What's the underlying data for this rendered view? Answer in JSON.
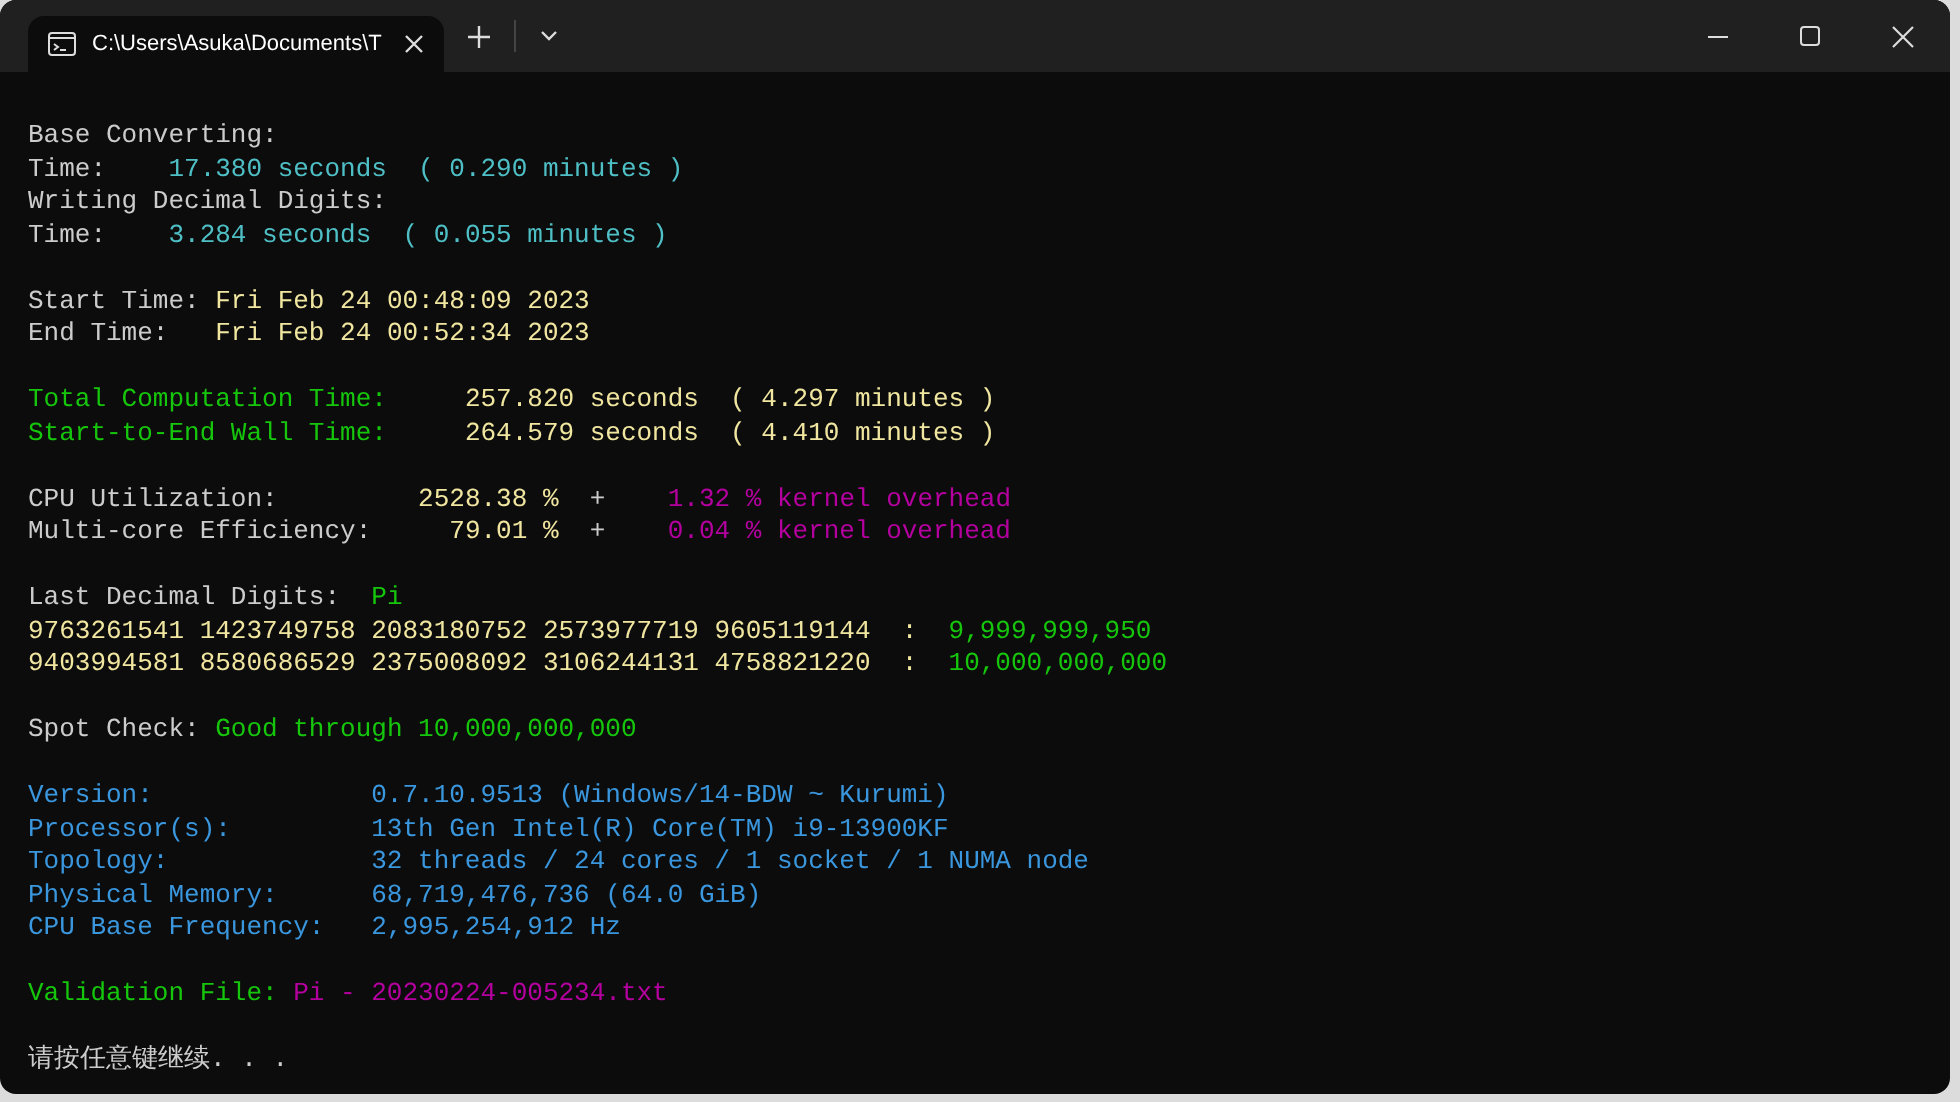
{
  "window": {
    "tab": {
      "title": "C:\\Users\\Asuka\\Documents\\T",
      "selected": true
    }
  },
  "terminal": {
    "blocks": [
      {
        "lines": [
          [
            {
              "text": "Base Converting:",
              "color": "#cccccc"
            }
          ],
          [
            {
              "text": "Time:    ",
              "color": "#cccccc"
            },
            {
              "text": "17.380 seconds  ( 0.290 minutes )",
              "color": "#4fbfc6"
            }
          ],
          [
            {
              "text": "Writing Decimal Digits:",
              "color": "#cccccc"
            }
          ],
          [
            {
              "text": "Time:    ",
              "color": "#cccccc"
            },
            {
              "text": "3.284 seconds  ( 0.055 minutes )",
              "color": "#4fbfc6"
            }
          ]
        ]
      },
      {
        "lines": [
          [
            {
              "text": "Start Time: ",
              "color": "#cccccc"
            },
            {
              "text": "Fri Feb 24 00:48:09 2023",
              "color": "#f0e6a0"
            }
          ],
          [
            {
              "text": "End Time:   ",
              "color": "#cccccc"
            },
            {
              "text": "Fri Feb 24 00:52:34 2023",
              "color": "#f0e6a0"
            }
          ]
        ]
      },
      {
        "lines": [
          [
            {
              "text": "Total Computation Time:     ",
              "color": "#16c60c"
            },
            {
              "text": "257.820 seconds  ( 4.297 minutes )",
              "color": "#f0e6a0"
            }
          ],
          [
            {
              "text": "Start-to-End Wall Time:     ",
              "color": "#16c60c"
            },
            {
              "text": "264.579 seconds  ( 4.410 minutes )",
              "color": "#f0e6a0"
            }
          ]
        ]
      },
      {
        "lines": [
          [
            {
              "text": "CPU Utilization:         ",
              "color": "#cccccc"
            },
            {
              "text": "2528.38 %",
              "color": "#f0e6a0"
            },
            {
              "text": "  +    ",
              "color": "#cccccc"
            },
            {
              "text": "1.32 % kernel overhead",
              "color": "#b4009e"
            }
          ],
          [
            {
              "text": "Multi-core Efficiency:     ",
              "color": "#cccccc"
            },
            {
              "text": "79.01 %",
              "color": "#f0e6a0"
            },
            {
              "text": "  +    ",
              "color": "#cccccc"
            },
            {
              "text": "0.04 % kernel overhead",
              "color": "#b4009e"
            }
          ]
        ]
      },
      {
        "lines": [
          [
            {
              "text": "Last Decimal Digits:  ",
              "color": "#cccccc"
            },
            {
              "text": "Pi",
              "color": "#16c60c"
            }
          ],
          [
            {
              "text": "9763261541 1423749758 2083180752 2573977719 9605119144  :  ",
              "color": "#f0e6a0"
            },
            {
              "text": "9,999,999,950",
              "color": "#16c60c"
            }
          ],
          [
            {
              "text": "9403994581 8580686529 2375008092 3106244131 4758821220  :  ",
              "color": "#f0e6a0"
            },
            {
              "text": "10,000,000,000",
              "color": "#16c60c"
            }
          ]
        ]
      },
      {
        "lines": [
          [
            {
              "text": "Spot Check: ",
              "color": "#cccccc"
            },
            {
              "text": "Good through 10,000,000,000",
              "color": "#16c60c"
            }
          ]
        ]
      },
      {
        "lines": [
          [
            {
              "text": "Version:              0.7.10.9513 (Windows/14-BDW ~ Kurumi)",
              "color": "#3a96dd"
            }
          ],
          [
            {
              "text": "Processor(s):         13th Gen Intel(R) Core(TM) i9-13900KF",
              "color": "#3a96dd"
            }
          ],
          [
            {
              "text": "Topology:             32 threads / 24 cores / 1 socket / 1 NUMA node",
              "color": "#3a96dd"
            }
          ],
          [
            {
              "text": "Physical Memory:      68,719,476,736 (64.0 GiB)",
              "color": "#3a96dd"
            }
          ],
          [
            {
              "text": "CPU Base Frequency:   2,995,254,912 Hz",
              "color": "#3a96dd"
            }
          ]
        ]
      },
      {
        "lines": [
          [
            {
              "text": "Validation File: ",
              "color": "#16c60c"
            },
            {
              "text": "Pi - 20230224-005234.txt",
              "color": "#b4009e"
            }
          ]
        ]
      },
      {
        "lines": [
          [
            {
              "text": "请按任意键继续. . .",
              "color": "#cccccc"
            }
          ]
        ]
      }
    ]
  }
}
